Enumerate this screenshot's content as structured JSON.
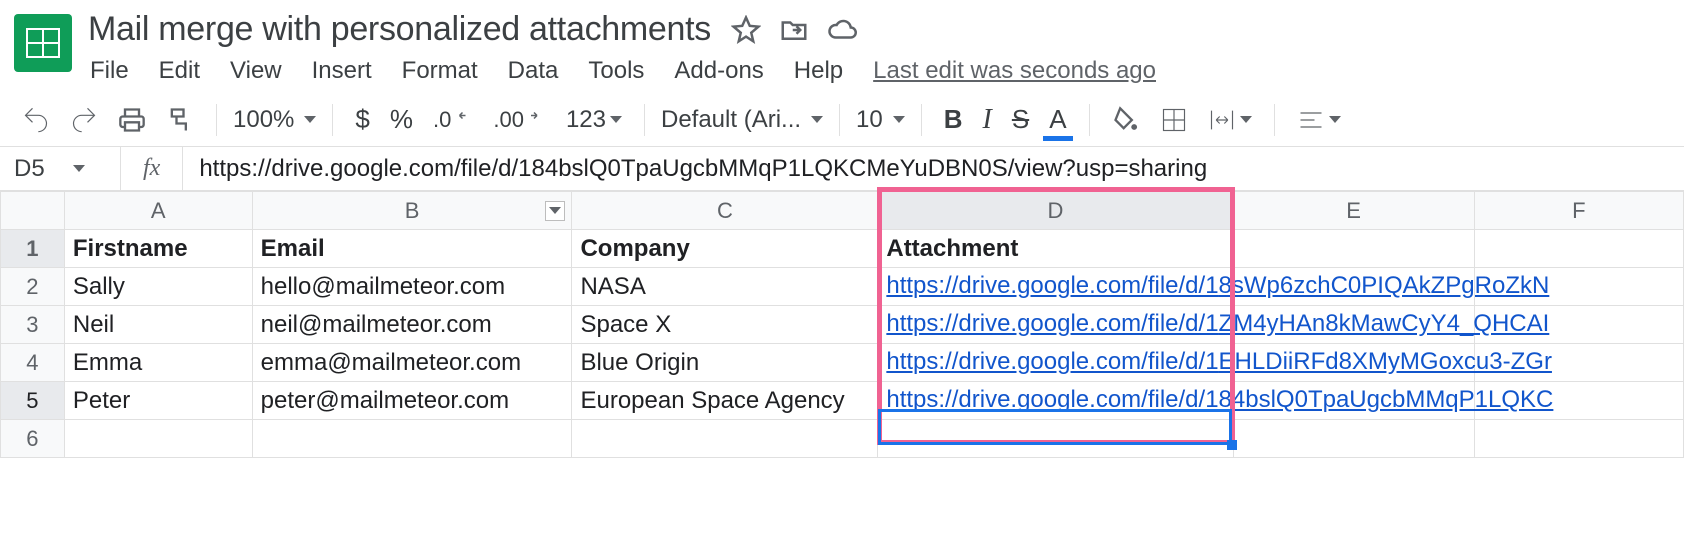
{
  "doc": {
    "title": "Mail merge with personalized attachments"
  },
  "menus": {
    "file": "File",
    "edit": "Edit",
    "view": "View",
    "insert": "Insert",
    "format": "Format",
    "data": "Data",
    "tools": "Tools",
    "addons": "Add-ons",
    "help": "Help",
    "last_edit": "Last edit was seconds ago"
  },
  "toolbar": {
    "zoom": "100%",
    "currency": "$",
    "percent": "%",
    "dec_dec": ".0",
    "inc_dec": ".00",
    "more_fmt": "123",
    "font": "Default (Ari...",
    "font_size": "10",
    "bold": "B",
    "italic": "I",
    "strike": "S",
    "text_color": "A"
  },
  "namebox": "D5",
  "formula": "https://drive.google.com/file/d/184bslQ0TpaUgcbMMqP1LQKCMeYuDBN0S/view?usp=sharing",
  "columns": [
    "A",
    "B",
    "C",
    "D",
    "E",
    "F"
  ],
  "headers": {
    "A": "Firstname",
    "B": "Email",
    "C": "Company",
    "D": "Attachment"
  },
  "rows": [
    {
      "n": 2,
      "A": "Sally",
      "B": "hello@mailmeteor.com",
      "C": "NASA",
      "D_left": "https://drive.google.com/file/d/1",
      "D_right": "8sWp6zchC0PIQAkZPgRoZkN"
    },
    {
      "n": 3,
      "A": "Neil",
      "B": "neil@mailmeteor.com",
      "C": "Space X",
      "D_left": "https://drive.google.com/file/d/1",
      "D_right": "ZM4yHAn8kMawCyY4_QHCAI"
    },
    {
      "n": 4,
      "A": "Emma",
      "B": "emma@mailmeteor.com",
      "C": "Blue Origin",
      "D_left": "https://drive.google.com/file/d/1",
      "D_right": "EHLDiiRFd8XMyMGoxcu3-ZGr"
    },
    {
      "n": 5,
      "A": "Peter",
      "B": "peter@mailmeteor.com",
      "C": "European Space Agency",
      "D_left": "https://drive.google.com/file/d/",
      "D_right": "184bslQ0TpaUgcbMMqP1LQKC"
    }
  ]
}
